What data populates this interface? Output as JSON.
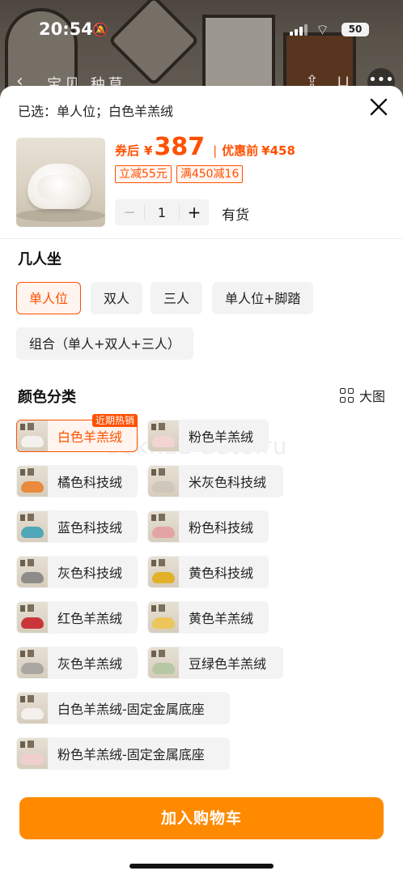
{
  "status_bar": {
    "time": "20:54",
    "battery": "50"
  },
  "background_nav": {
    "tabs": "宝贝 种草"
  },
  "sheet": {
    "selected_text": "已选：单人位；白色羊羔绒",
    "price": {
      "coupon_label": "券后",
      "currency": "¥",
      "amount": "387",
      "before_label": "优惠前",
      "before_price": "¥458"
    },
    "promos": [
      "立减55元",
      "满450减16"
    ],
    "quantity": "1",
    "stock_status": "有货"
  },
  "seats": {
    "title": "几人坐",
    "options": [
      "单人位",
      "双人",
      "三人",
      "单人位+脚踏",
      "组合（单人+双人+三人）"
    ],
    "selected_index": 0
  },
  "colors": {
    "title": "颜色分类",
    "big_view_label": "大图",
    "hot_tag": "近期热销",
    "options": [
      {
        "label": "白色羊羔绒",
        "color": "#f4f1ec"
      },
      {
        "label": "粉色羊羔绒",
        "color": "#f2d5d3"
      },
      {
        "label": "橘色科技绒",
        "color": "#e98a3c"
      },
      {
        "label": "米灰色科技绒",
        "color": "#cfc7b9"
      },
      {
        "label": "蓝色科技绒",
        "color": "#4fa7b8"
      },
      {
        "label": "粉色科技绒",
        "color": "#e3a4a6"
      },
      {
        "label": "灰色科技绒",
        "color": "#8e8c8a"
      },
      {
        "label": "黄色科技绒",
        "color": "#e2b12a"
      },
      {
        "label": "红色羊羔绒",
        "color": "#c9353a"
      },
      {
        "label": "黄色羊羔绒",
        "color": "#ecc65a"
      },
      {
        "label": "灰色羊羔绒",
        "color": "#a9a6a2"
      },
      {
        "label": "豆绿色羊羔绒",
        "color": "#b7c7a4"
      },
      {
        "label": "白色羊羔绒-固定金属底座",
        "color": "#f4f1ec"
      },
      {
        "label": "粉色羊羔绒-固定金属底座",
        "color": "#f0d0cf"
      }
    ],
    "selected_index": 0
  },
  "watermark": "abkhaz-auto.ru",
  "cta_label": "加入购物车"
}
